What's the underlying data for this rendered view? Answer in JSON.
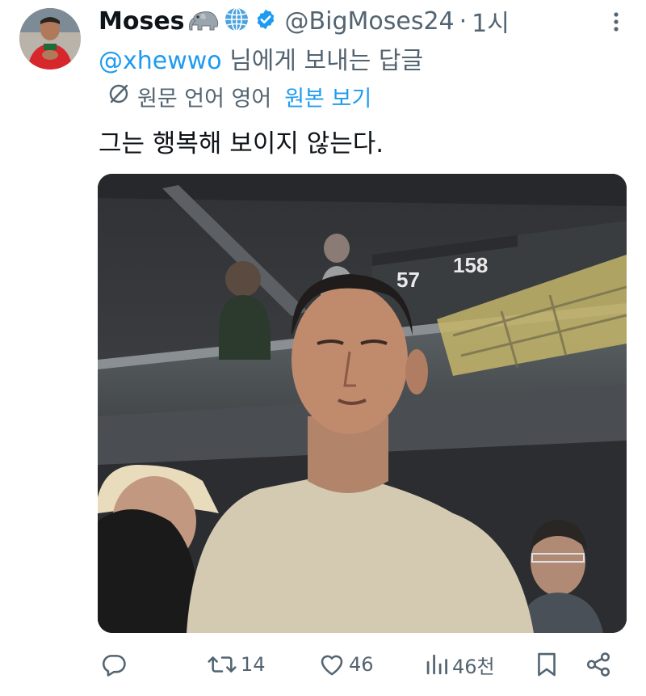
{
  "author": {
    "display_name": "Moses",
    "handle": "@BigMoses24",
    "separator": "·",
    "time_ago": "1시",
    "emoji_icons": [
      "elephant-emoji-icon",
      "globe-emoji-icon"
    ],
    "verified_color": "#1d9bf0"
  },
  "reply": {
    "mention": "@xhewwo",
    "suffix": " 님에게 보내는 답글"
  },
  "translation": {
    "label": "원문 언어 영어",
    "link": "원본 보기"
  },
  "tweet": {
    "text": "그는 행복해 보이지 않는다."
  },
  "media": {
    "scoreboard_numbers": [
      "57",
      "158"
    ]
  },
  "actions": {
    "reply_count": "",
    "retweet_count": "14",
    "like_count": "46",
    "views_count": "46천"
  },
  "colors": {
    "accent": "#1d9bf0",
    "muted": "#536471",
    "text": "#0f1419"
  }
}
